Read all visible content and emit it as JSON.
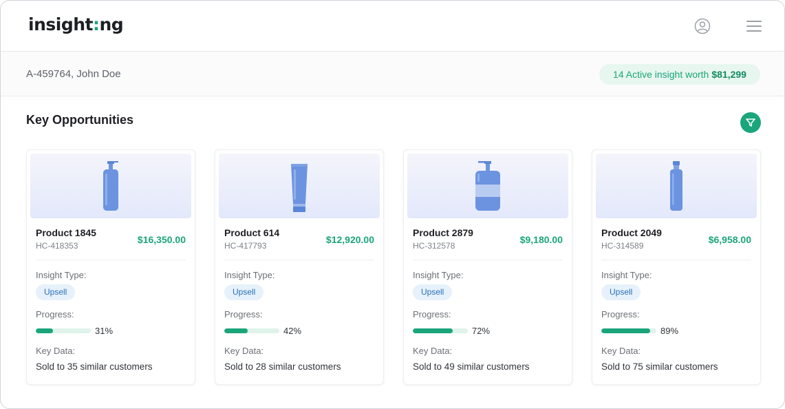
{
  "header": {
    "logo_text_before": "insight",
    "logo_dot": ":",
    "logo_text_after": "ng",
    "user_icon": "user-circle-icon",
    "menu_icon": "hamburger-menu-icon"
  },
  "account": {
    "label": "A-459764, John Doe"
  },
  "insights_badge": {
    "text": "14 Active insight worth",
    "value": "$81,299"
  },
  "section": {
    "title": "Key Opportunities",
    "filter_icon": "filter-icon"
  },
  "labels": {
    "insight_type": "Insight Type:",
    "progress": "Progress:",
    "key_data": "Key Data:"
  },
  "colors": {
    "accent": "#1aa57a",
    "tag_bg": "#e6f1fb",
    "tag_text": "#2a6fb7"
  },
  "products": [
    {
      "name": "Product 1845",
      "sku": "HC-418353",
      "price": "$16,350.00",
      "insight_type": "Upsell",
      "progress": 31,
      "progress_label": "31%",
      "key_data": "Sold to 35 similar customers",
      "icon": "pump-bottle-icon"
    },
    {
      "name": "Product 614",
      "sku": "HC-417793",
      "price": "$12,920.00",
      "insight_type": "Upsell",
      "progress": 42,
      "progress_label": "42%",
      "key_data": "Sold to 28 similar customers",
      "icon": "tube-icon"
    },
    {
      "name": "Product 2879",
      "sku": "HC-312578",
      "price": "$9,180.00",
      "insight_type": "Upsell",
      "progress": 72,
      "progress_label": "72%",
      "key_data": "Sold to 49 similar customers",
      "icon": "soap-dispenser-icon"
    },
    {
      "name": "Product 2049",
      "sku": "HC-314589",
      "price": "$6,958.00",
      "insight_type": "Upsell",
      "progress": 89,
      "progress_label": "89%",
      "key_data": "Sold to 75 similar customers",
      "icon": "spray-bottle-icon"
    }
  ]
}
